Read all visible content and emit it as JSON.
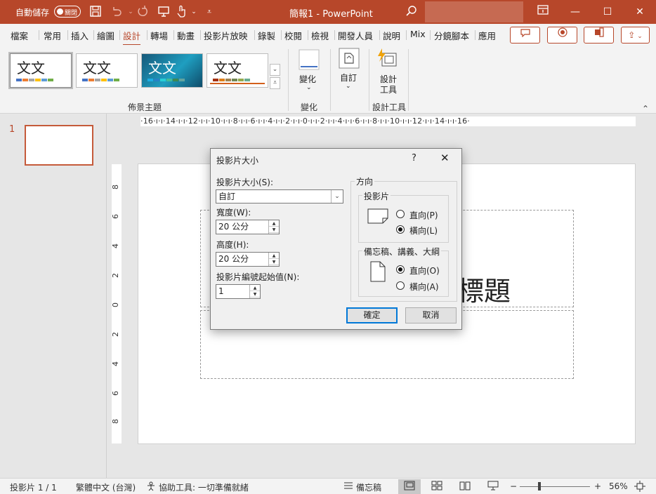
{
  "titlebar": {
    "autosave_label": "自動儲存",
    "autosave_state": "關閉",
    "doc_title": "簡報1  -  PowerPoint",
    "icons": [
      "save-icon",
      "undo-icon",
      "redo-icon",
      "presenter-icon",
      "touch-mode-icon",
      "customize-icon",
      "search-icon",
      "ribbon-display-icon",
      "minimize-icon",
      "maximize-icon",
      "close-icon"
    ]
  },
  "menu": {
    "tabs": [
      "檔案",
      "常用",
      "插入",
      "繪圖",
      "設計",
      "轉場",
      "動畫",
      "投影片放映",
      "錄製",
      "校閱",
      "檢視",
      "開發人員",
      "說明",
      "Mix",
      "分鏡腳本",
      "應用"
    ],
    "active_tab": "設計"
  },
  "ribbon": {
    "themes": [
      {
        "text": "文文",
        "colors": [
          "#4472c4",
          "#ed7d31",
          "#a5a5a5",
          "#ffc000",
          "#5b9bd5",
          "#70ad47"
        ]
      },
      {
        "text": "文文",
        "colors": [
          "#4472c4",
          "#ed7d31",
          "#a5a5a5",
          "#ffc000",
          "#5b9bd5",
          "#70ad47"
        ]
      },
      {
        "text": "文文",
        "colors": [
          "#1cade4",
          "#2683c6",
          "#27ced7",
          "#42ba97",
          "#3e8853",
          "#62a39f"
        ]
      },
      {
        "text": "文文",
        "colors": [
          "#a53010",
          "#de7e18",
          "#9f8351",
          "#728653",
          "#92aa4c",
          "#6aac91"
        ]
      }
    ],
    "group_themes": "佈景主題",
    "variants_label": "變化",
    "variants_group": "變化",
    "customize_label": "自訂",
    "designer_label_1": "設計",
    "designer_label_2": "工具",
    "designer_group": "設計工具"
  },
  "right_buttons": [
    "comment-icon",
    "record-icon",
    "teams-share-icon",
    "share-icon"
  ],
  "thumbnails": {
    "number": "1"
  },
  "ruler": {
    "horizontal": "·16·ı·ı·14·ı·ı·12·ı·ı·10·ı·ı·8·ı·ı·6·ı·ı·4·ı·ı·2·ı·ı·0·ı·ı·2·ı·ı·4·ı·ı·6·ı·ı·8·ı·ı·10·ı·ı·12·ı·ı·14·ı·ı·16·",
    "vertical": [
      "8",
      "6",
      "4",
      "2",
      "0",
      "2",
      "4",
      "6",
      "8"
    ]
  },
  "slide": {
    "title_fragment": "標題"
  },
  "dialog": {
    "title": "投影片大小",
    "help": "?",
    "close": "✕",
    "size_label": "投影片大小(S):",
    "size_value": "自訂",
    "width_label": "寬度(W):",
    "width_value": "20 公分",
    "height_label": "高度(H):",
    "height_value": "20 公分",
    "number_label": "投影片編號起始值(N):",
    "number_value": "1",
    "orientation_label": "方向",
    "slides_group": "投影片",
    "slides_portrait": "直向(P)",
    "slides_landscape": "橫向(L)",
    "notes_group": "備忘稿、講義、大綱",
    "notes_portrait": "直向(O)",
    "notes_landscape": "橫向(A)",
    "ok": "確定",
    "cancel": "取消"
  },
  "statusbar": {
    "slide_count": "投影片 1 / 1",
    "language": "繁體中文 (台灣)",
    "accessibility": "協助工具: 一切準備就緒",
    "notes": "備忘稿",
    "zoom": "56%",
    "zoom_minus": "−",
    "zoom_plus": "+"
  }
}
